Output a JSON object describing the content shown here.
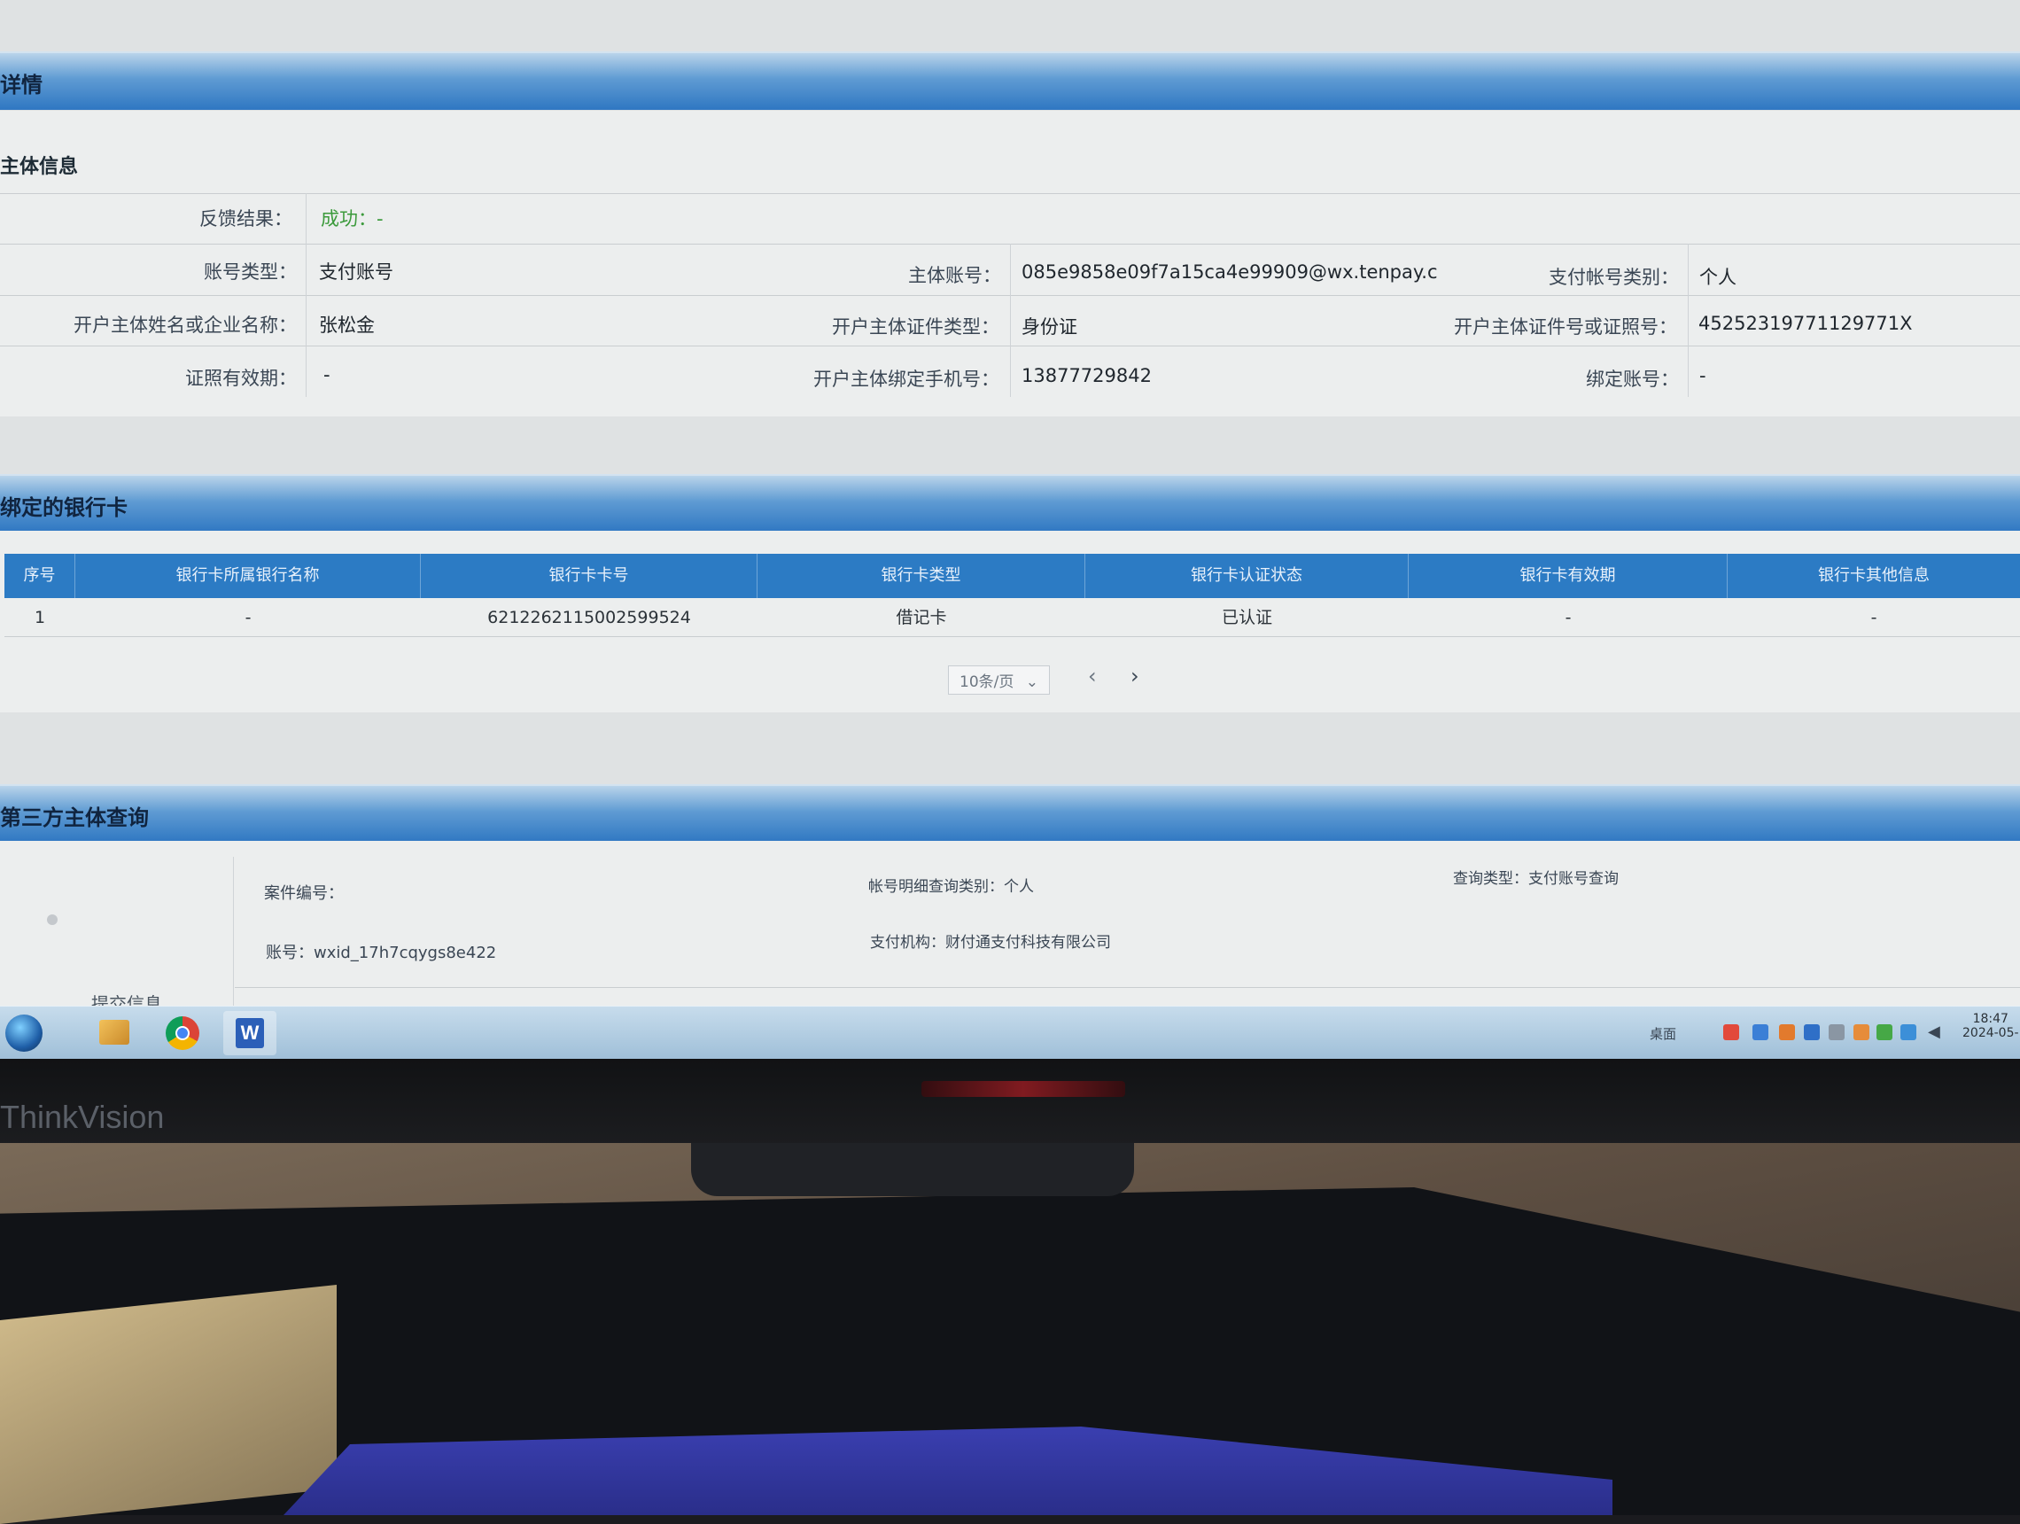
{
  "sections": {
    "details_title": "详情",
    "subject_info_title": "主体信息",
    "bank_cards_title": "绑定的银行卡",
    "third_party_title": "第三方主体查询"
  },
  "subject_info": {
    "feedback_label": "反馈结果：",
    "feedback_value": "成功：-",
    "account_type_label": "账号类型：",
    "account_type_value": "支付账号",
    "subject_account_label": "主体账号：",
    "subject_account_value": "085e9858e09f7a15ca4e99909@wx.tenpay.c",
    "payment_category_label": "支付帐号类别：",
    "payment_category_value": "个人",
    "holder_name_label": "开户主体姓名或企业名称：",
    "holder_name_value": "张松金",
    "id_type_label": "开户主体证件类型：",
    "id_type_value": "身份证",
    "id_number_label": "开户主体证件号或证照号：",
    "id_number_value": "452523197711297​71X",
    "license_validity_label": "证照有效期：",
    "license_validity_value": "-",
    "bound_phone_label": "开户主体绑定手机号：",
    "bound_phone_value": "13877729842",
    "bound_account_label": "绑定账号：",
    "bound_account_value": "-"
  },
  "bank_table": {
    "headers": [
      "序号",
      "银行卡所属银行名称",
      "银行卡卡号",
      "银行卡类型",
      "银行卡认证状态",
      "银行卡有效期",
      "银行卡其他信息"
    ],
    "rows": [
      [
        "1",
        "-",
        "6212262115002599524",
        "借记卡",
        "已认证",
        "-",
        "-"
      ]
    ],
    "page_size": "10条/页",
    "prev_symbol": "‹",
    "next_symbol": "›"
  },
  "third_party": {
    "case_number_label": "案件编号：",
    "detail_query_type": "帐号明细查询类别：个人",
    "query_type": "查询类型：支付账号查询",
    "account": "账号：wxid_17h7cqygs8e422",
    "payment_institution": "支付机构：财付通支付科技有限公司",
    "submit_info": "提交信息"
  },
  "taskbar": {
    "clock_time": "18:47",
    "clock_date": "2024-05-",
    "tray_label": "桌面",
    "apps": [
      "start-orb",
      "file-explorer",
      "chrome",
      "word"
    ]
  },
  "monitor": {
    "brand": "ThinkVision"
  }
}
